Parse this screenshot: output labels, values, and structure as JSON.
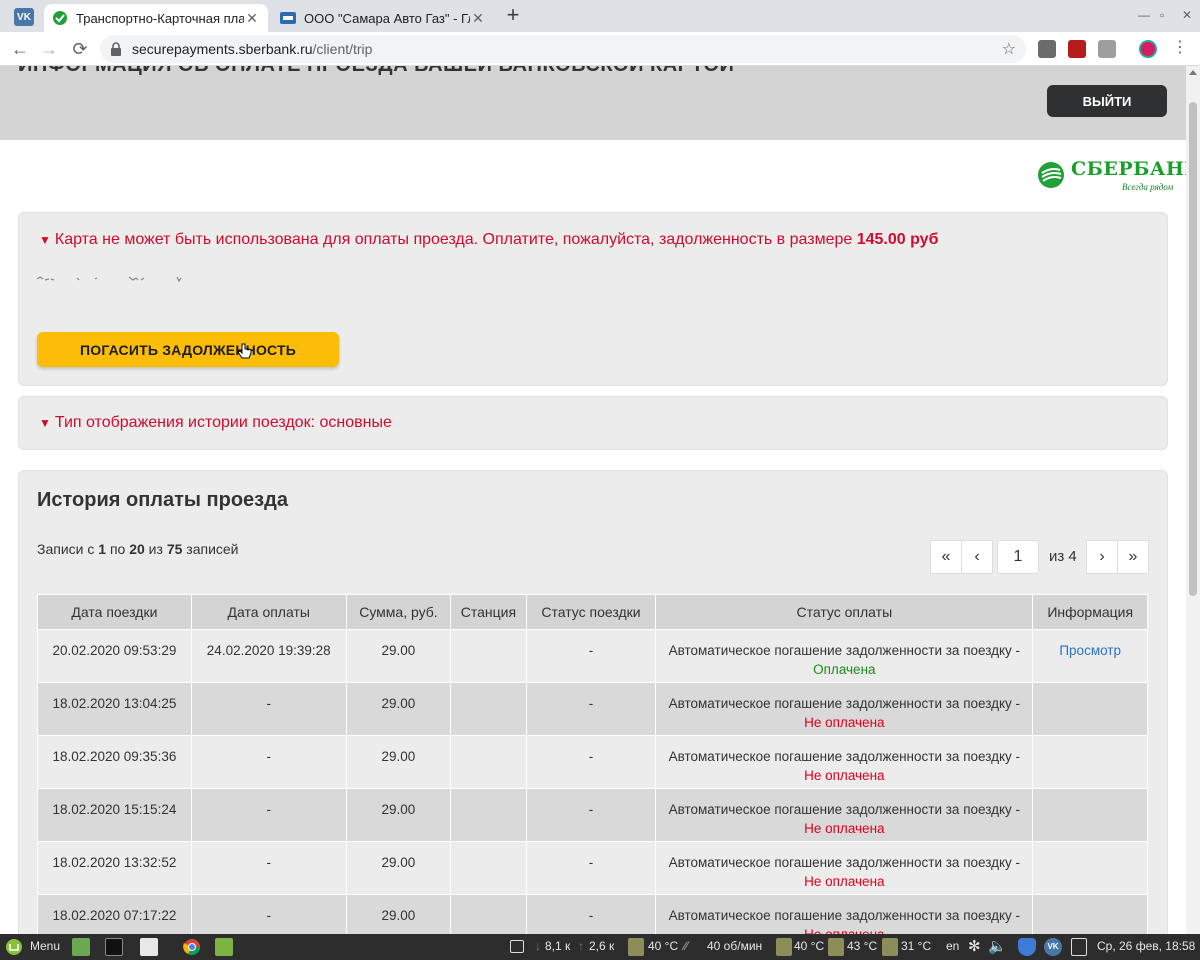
{
  "browser": {
    "tabs": [
      {
        "title": "Транспортно-Карточная пла",
        "active": true
      },
      {
        "title": "ООО \"Самара Авто Газ\" - Гла",
        "active": false
      }
    ],
    "url_host": "securepayments.sberbank.ru",
    "url_path": "/client/trip"
  },
  "header": {
    "cut_title": "ИНФОРМАЦИЯ ОБ ОПЛАТЕ ПРОЕЗДА ВАШЕЙ БАНКОВСКОЙ КАРТОЙ",
    "logout_label": "ВЫЙТИ"
  },
  "logo": {
    "name": "СБЕРБАНК",
    "slogan": "Всегда рядом"
  },
  "debt_panel": {
    "message": "Карта не может быть использована для оплаты проезда. Оплатите, пожалуйста, задолженность в размере",
    "amount": "145.00 руб",
    "pay_button": "ПОГАСИТЬ ЗАДОЛЖЕННОСТЬ"
  },
  "display_panel": {
    "message": "Тип отображения истории поездок: основные"
  },
  "history": {
    "title": "История оплаты проезда",
    "records_prefix": "Записи с",
    "records_from": "1",
    "records_by": "по",
    "records_to": "20",
    "records_of": "из",
    "records_total": "75",
    "records_suffix": "записей",
    "pager": {
      "first": "«",
      "prev": "‹",
      "current": "1",
      "of_label": "из 4",
      "next": "›",
      "last": "»"
    },
    "columns": [
      "Дата поездки",
      "Дата оплаты",
      "Сумма, руб.",
      "Станция",
      "Статус поездки",
      "Статус оплаты",
      "Информация"
    ],
    "rows": [
      {
        "trip_date": "20.02.2020 09:53:29",
        "pay_date": "24.02.2020 19:39:28",
        "sum": "29.00",
        "station": "",
        "trip_status": "-",
        "pay_status": "Автоматическое погашение задолженности за поездку -",
        "result": "Оплачена",
        "result_kind": "paid",
        "info": "Просмотр"
      },
      {
        "trip_date": "18.02.2020 13:04:25",
        "pay_date": "-",
        "sum": "29.00",
        "station": "",
        "trip_status": "-",
        "pay_status": "Автоматическое погашение задолженности за поездку -",
        "result": "Не оплачена",
        "result_kind": "unpaid",
        "info": ""
      },
      {
        "trip_date": "18.02.2020 09:35:36",
        "pay_date": "-",
        "sum": "29.00",
        "station": "",
        "trip_status": "-",
        "pay_status": "Автоматическое погашение задолженности за поездку -",
        "result": "Не оплачена",
        "result_kind": "unpaid",
        "info": ""
      },
      {
        "trip_date": "18.02.2020 15:15:24",
        "pay_date": "-",
        "sum": "29.00",
        "station": "",
        "trip_status": "-",
        "pay_status": "Автоматическое погашение задолженности за поездку -",
        "result": "Не оплачена",
        "result_kind": "unpaid",
        "info": ""
      },
      {
        "trip_date": "18.02.2020 13:32:52",
        "pay_date": "-",
        "sum": "29.00",
        "station": "",
        "trip_status": "-",
        "pay_status": "Автоматическое погашение задолженности за поездку -",
        "result": "Не оплачена",
        "result_kind": "unpaid",
        "info": ""
      },
      {
        "trip_date": "18.02.2020 07:17:22",
        "pay_date": "-",
        "sum": "29.00",
        "station": "",
        "trip_status": "-",
        "pay_status": "Автоматическое погашение задолженности за поездку -",
        "result": "Не оплачена",
        "result_kind": "unpaid",
        "info": ""
      }
    ]
  },
  "taskbar": {
    "menu_label": "Menu",
    "net_down": "8,1 к",
    "net_up": "2,6 к",
    "temp1": "40 °C",
    "fan": "40 об/мин",
    "temp2": "40 °C",
    "temp3": "43 °C",
    "temp4": "31 °C",
    "lang": "en",
    "clock": "Ср, 26 фев, 18:58"
  },
  "colors": {
    "alert": "#d10a2f",
    "pay_button": "#fbbd07",
    "paid": "#1b8a1b",
    "unpaid": "#e0001a",
    "sber_green": "#1a9f29"
  }
}
